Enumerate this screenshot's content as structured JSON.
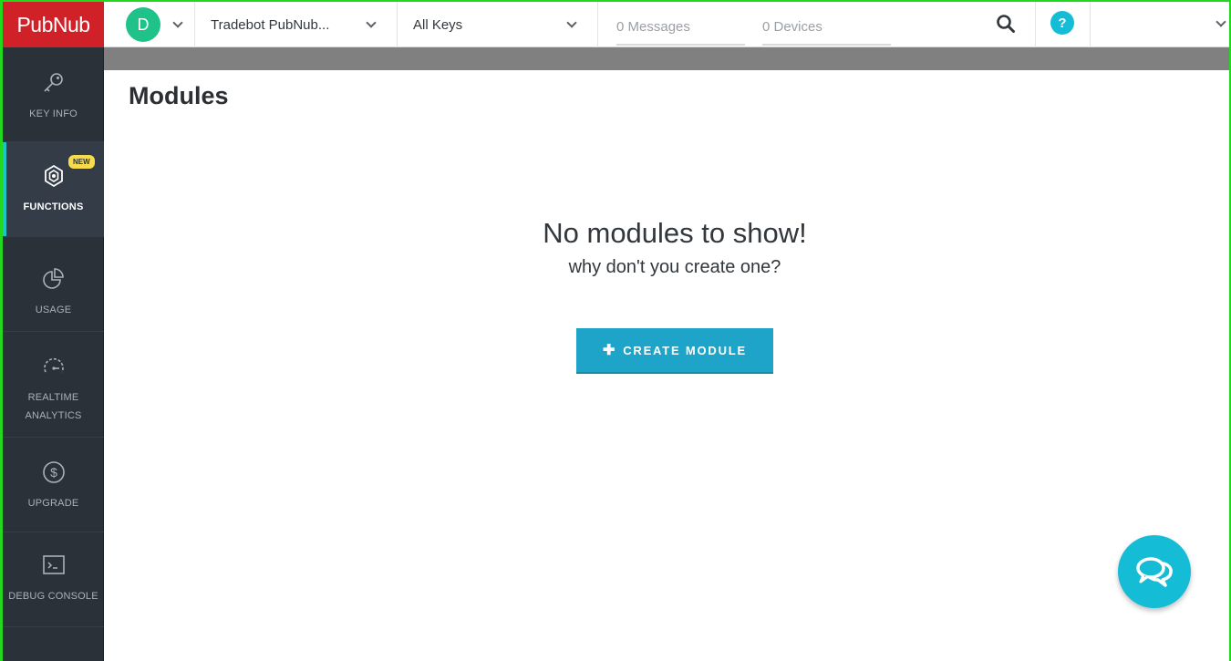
{
  "topbar": {
    "logo": "PubNub",
    "avatar_initial": "D",
    "app_name": "Tradebot PubNub...",
    "keys_label": "All Keys",
    "messages_stat": "0 Messages",
    "devices_stat": "0 Devices",
    "help_glyph": "?"
  },
  "sidebar": {
    "items": [
      {
        "label": "KEY INFO",
        "icon": "key-icon"
      },
      {
        "label": "FUNCTIONS",
        "icon": "hexagon-icon",
        "badge": "NEW",
        "active": true
      },
      {
        "label": "USAGE",
        "icon": "pie-chart-icon"
      },
      {
        "label": "REALTIME ANALYTICS",
        "icon": "speedometer-icon"
      },
      {
        "label": "UPGRADE",
        "icon": "dollar-icon"
      },
      {
        "label": "DEBUG CONSOLE",
        "icon": "terminal-icon"
      }
    ]
  },
  "main": {
    "title": "Modules",
    "empty_title": "No modules to show!",
    "empty_subtitle": "why don't you create one?",
    "create_button": "CREATE MODULE"
  },
  "colors": {
    "brand_red": "#d02129",
    "accent_cyan": "#15bcd6",
    "button_blue": "#1ea4c9",
    "sidebar_bg": "#2a3139",
    "avatar_green": "#1fc289",
    "badge_yellow": "#f6db4a"
  }
}
